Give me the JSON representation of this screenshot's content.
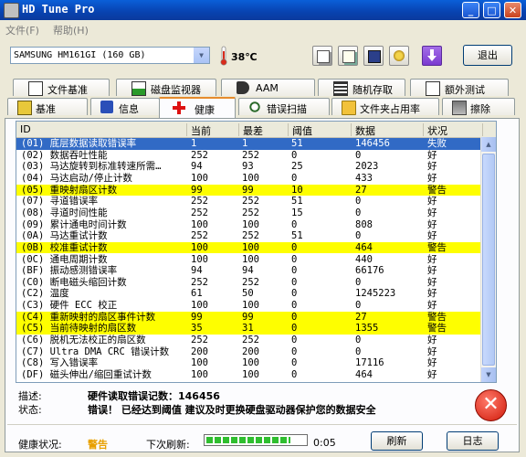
{
  "window": {
    "title": "HD Tune Pro",
    "minimize": "_",
    "maximize": "□",
    "close": "✕"
  },
  "menu": {
    "file": "文件(F)",
    "help": "帮助(H)"
  },
  "toolbar": {
    "drive": "SAMSUNG HM161GI (160 GB)",
    "temperature": "38℃",
    "exit_label": "退出",
    "buttons": [
      "copy-icon",
      "copy-text-icon",
      "save-icon",
      "options-icon",
      "download-icon"
    ]
  },
  "tabs_top": [
    {
      "label": "文件基准",
      "icon": "file-benchmark-icon"
    },
    {
      "label": "磁盘监视器",
      "icon": "disk-monitor-icon"
    },
    {
      "label": "AAM",
      "icon": "speaker-icon"
    },
    {
      "label": "随机存取",
      "icon": "random-access-icon"
    },
    {
      "label": "额外测试",
      "icon": "extra-tests-icon"
    }
  ],
  "tabs_bottom": [
    {
      "label": "基准",
      "icon": "benchmark-icon"
    },
    {
      "label": "信息",
      "icon": "info-icon"
    },
    {
      "label": "健康",
      "icon": "health-icon"
    },
    {
      "label": "错误扫描",
      "icon": "error-scan-icon"
    },
    {
      "label": "文件夹占用率",
      "icon": "folder-usage-icon"
    },
    {
      "label": "擦除",
      "icon": "erase-icon"
    }
  ],
  "table": {
    "columns": [
      "ID",
      "当前",
      "最差",
      "阈值",
      "数据",
      "状况"
    ],
    "rows": [
      {
        "id": "(01) 底层数据读取错误率",
        "cur": "1",
        "worst": "1",
        "thr": "51",
        "data": "146456",
        "status": "失败",
        "hl": "sel"
      },
      {
        "id": "(02) 数据吞吐性能",
        "cur": "252",
        "worst": "252",
        "thr": "0",
        "data": "0",
        "status": "好",
        "hl": ""
      },
      {
        "id": "(03) 马达旋转到标准转速所需…",
        "cur": "94",
        "worst": "93",
        "thr": "25",
        "data": "2023",
        "status": "好",
        "hl": ""
      },
      {
        "id": "(04) 马达启动/停止计数",
        "cur": "100",
        "worst": "100",
        "thr": "0",
        "data": "433",
        "status": "好",
        "hl": ""
      },
      {
        "id": "(05) 重映射扇区计数",
        "cur": "99",
        "worst": "99",
        "thr": "10",
        "data": "27",
        "status": "警告",
        "hl": "warn"
      },
      {
        "id": "(07) 寻道错误率",
        "cur": "252",
        "worst": "252",
        "thr": "51",
        "data": "0",
        "status": "好",
        "hl": ""
      },
      {
        "id": "(08) 寻道时间性能",
        "cur": "252",
        "worst": "252",
        "thr": "15",
        "data": "0",
        "status": "好",
        "hl": ""
      },
      {
        "id": "(09) 累计通电时间计数",
        "cur": "100",
        "worst": "100",
        "thr": "0",
        "data": "808",
        "status": "好",
        "hl": ""
      },
      {
        "id": "(0A) 马达重试计数",
        "cur": "252",
        "worst": "252",
        "thr": "51",
        "data": "0",
        "status": "好",
        "hl": ""
      },
      {
        "id": "(0B) 校准重试计数",
        "cur": "100",
        "worst": "100",
        "thr": "0",
        "data": "464",
        "status": "警告",
        "hl": "warn"
      },
      {
        "id": "(0C) 通电周期计数",
        "cur": "100",
        "worst": "100",
        "thr": "0",
        "data": "440",
        "status": "好",
        "hl": ""
      },
      {
        "id": "(BF) 振动感测错误率",
        "cur": "94",
        "worst": "94",
        "thr": "0",
        "data": "66176",
        "status": "好",
        "hl": ""
      },
      {
        "id": "(C0) 断电磁头缩回计数",
        "cur": "252",
        "worst": "252",
        "thr": "0",
        "data": "0",
        "status": "好",
        "hl": ""
      },
      {
        "id": "(C2) 温度",
        "cur": "61",
        "worst": "50",
        "thr": "0",
        "data": "1245223",
        "status": "好",
        "hl": ""
      },
      {
        "id": "(C3) 硬件 ECC 校正",
        "cur": "100",
        "worst": "100",
        "thr": "0",
        "data": "0",
        "status": "好",
        "hl": ""
      },
      {
        "id": "(C4) 重新映射的扇区事件计数",
        "cur": "99",
        "worst": "99",
        "thr": "0",
        "data": "27",
        "status": "警告",
        "hl": "warn"
      },
      {
        "id": "(C5) 当前待映射的扇区数",
        "cur": "35",
        "worst": "31",
        "thr": "0",
        "data": "1355",
        "status": "警告",
        "hl": "warn"
      },
      {
        "id": "(C6) 脱机无法校正的扇区数",
        "cur": "252",
        "worst": "252",
        "thr": "0",
        "data": "0",
        "status": "好",
        "hl": ""
      },
      {
        "id": "(C7) Ultra DMA CRC 错误计数",
        "cur": "200",
        "worst": "200",
        "thr": "0",
        "data": "0",
        "status": "好",
        "hl": ""
      },
      {
        "id": "(C8) 写入错误率",
        "cur": "100",
        "worst": "100",
        "thr": "0",
        "data": "17116",
        "status": "好",
        "hl": ""
      },
      {
        "id": "(DF) 磁头伸出/缩回重试计数",
        "cur": "100",
        "worst": "100",
        "thr": "0",
        "data": "464",
        "status": "好",
        "hl": ""
      }
    ]
  },
  "details": {
    "desc_label": "描述:",
    "desc_value": "硬件读取错误记数：146456",
    "status_label": "状态:",
    "status_value": "错误！ 已经达到阈值 建议及时更换硬盘驱动器保护您的数据安全"
  },
  "footer": {
    "health_label": "健康状况:",
    "health_value": "警告",
    "health_color": "#e8a000",
    "next_refresh_label": "下次刷新:",
    "timer": "0:05",
    "refresh_progress": 0.85,
    "refresh_label": "刷新",
    "log_label": "日志"
  }
}
